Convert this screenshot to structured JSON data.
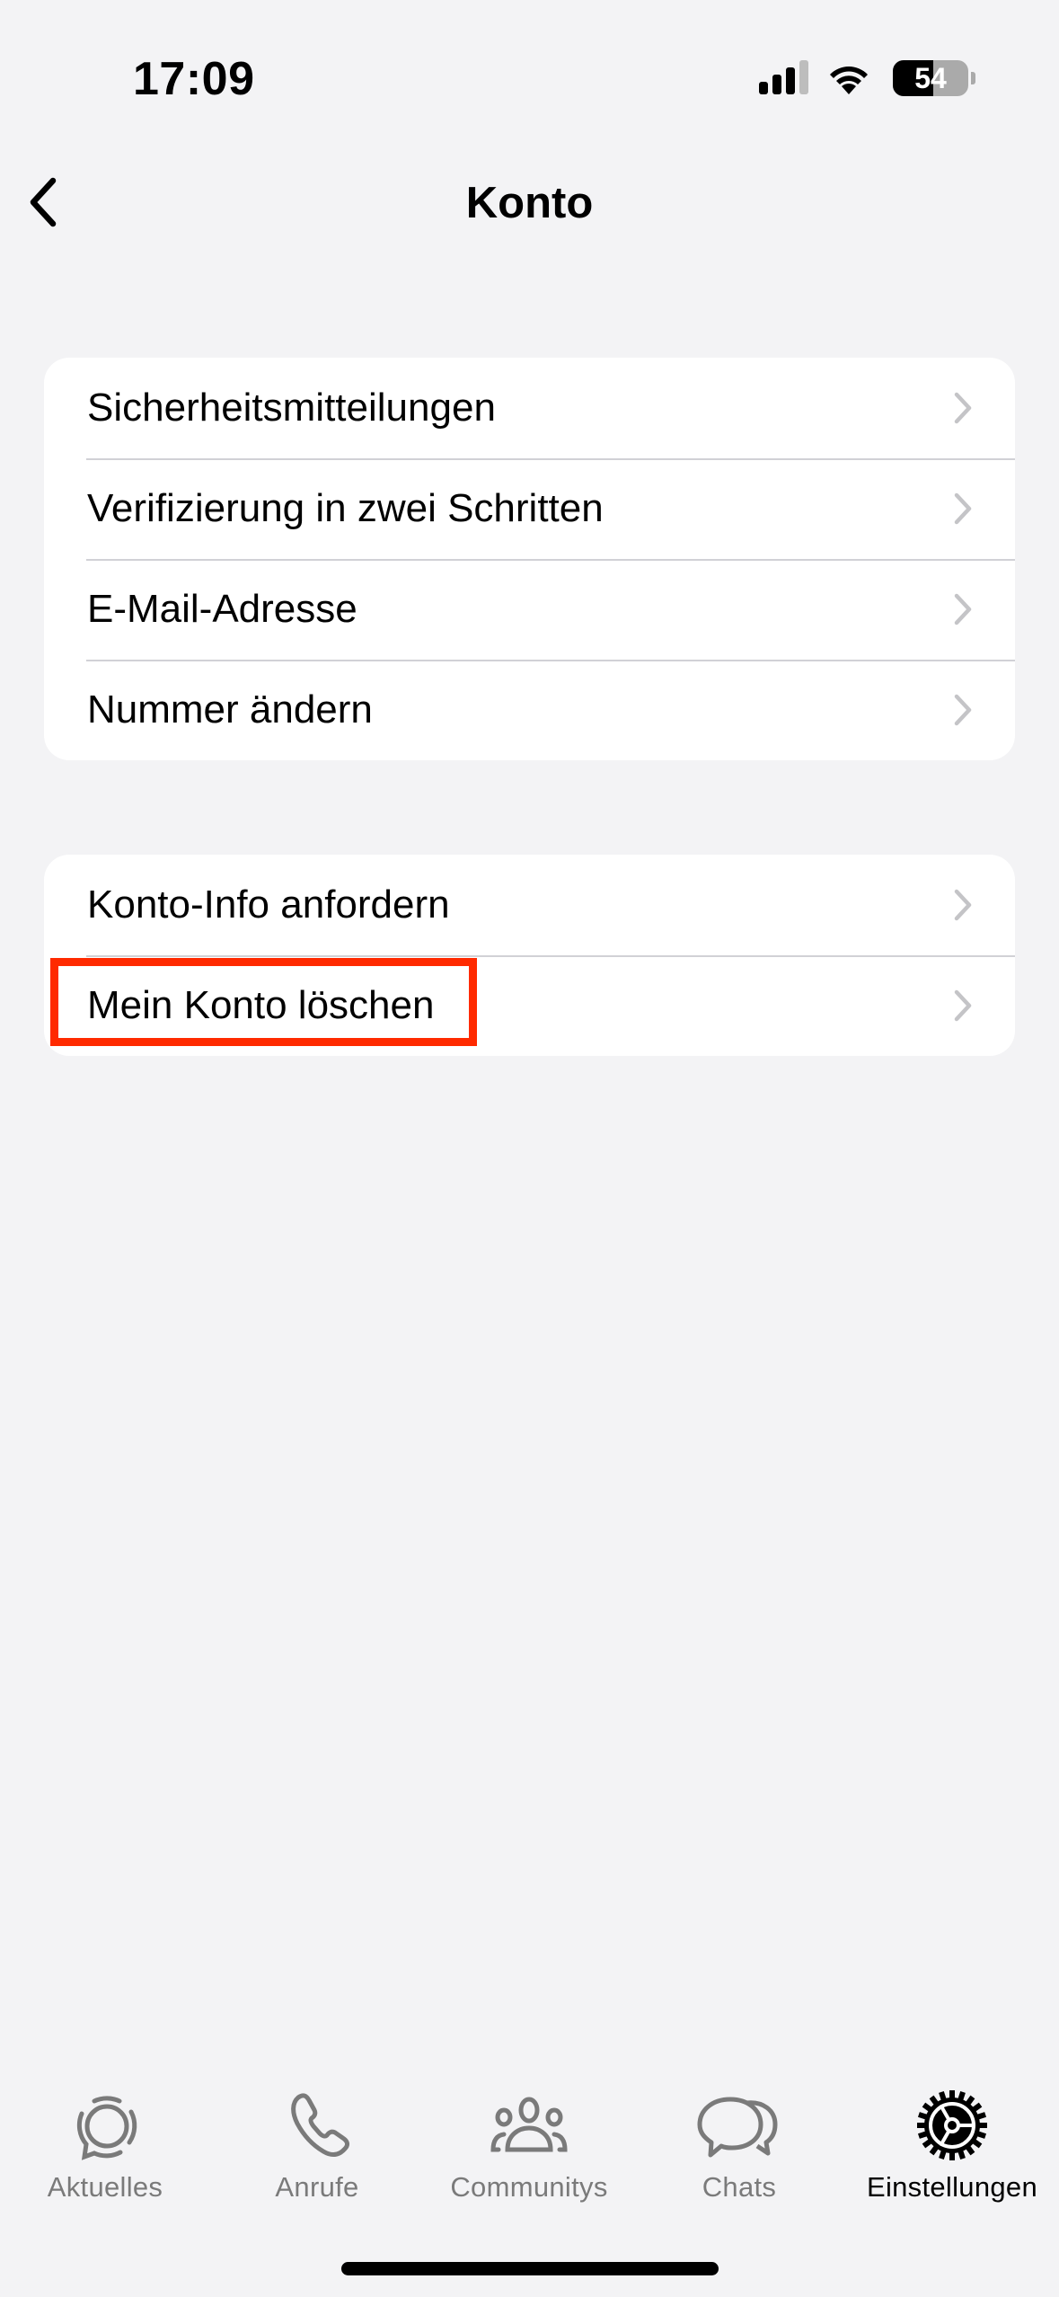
{
  "status_bar": {
    "time": "17:09",
    "signal_bars_active": 3,
    "signal_bars_total": 4,
    "wifi": "wifi-icon",
    "battery_percent": 54,
    "battery_label": "54"
  },
  "nav": {
    "back_icon": "chevron-left-icon",
    "title": "Konto"
  },
  "groups": [
    {
      "items": [
        {
          "label": "Sicherheitsmitteilungen",
          "icon": "chevron-right-icon"
        },
        {
          "label": "Verifizierung in zwei Schritten",
          "icon": "chevron-right-icon"
        },
        {
          "label": "E-Mail-Adresse",
          "icon": "chevron-right-icon"
        },
        {
          "label": "Nummer ändern",
          "icon": "chevron-right-icon"
        }
      ]
    },
    {
      "items": [
        {
          "label": "Konto-Info anfordern",
          "icon": "chevron-right-icon"
        },
        {
          "label": "Mein Konto löschen",
          "icon": "chevron-right-icon",
          "highlighted": true
        }
      ]
    }
  ],
  "highlight": {
    "target": "Mein Konto löschen",
    "color": "#FF2A00"
  },
  "tab_bar": {
    "tabs": [
      {
        "label": "Aktuelles",
        "icon": "updates-icon",
        "active": false
      },
      {
        "label": "Anrufe",
        "icon": "phone-icon",
        "active": false
      },
      {
        "label": "Communitys",
        "icon": "communities-icon",
        "active": false
      },
      {
        "label": "Chats",
        "icon": "chats-icon",
        "active": false
      },
      {
        "label": "Einstellungen",
        "icon": "settings-gear-icon",
        "active": true
      }
    ],
    "inactive_color": "#7A7A7A",
    "active_color": "#000000"
  }
}
